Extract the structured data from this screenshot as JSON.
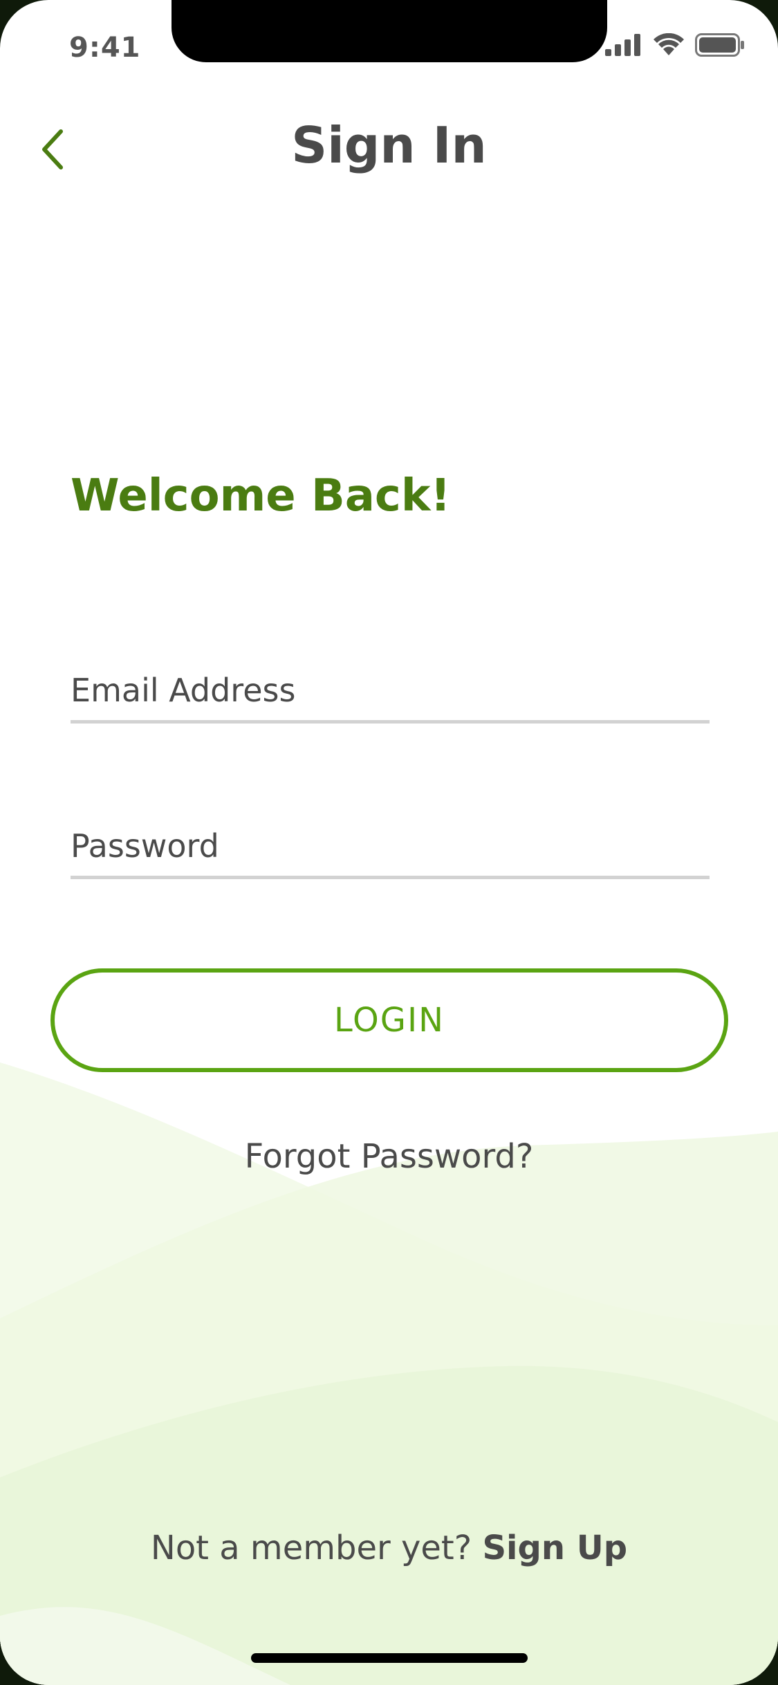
{
  "status_bar": {
    "time": "9:41",
    "icons": [
      "signal-icon",
      "wifi-icon",
      "battery-icon"
    ]
  },
  "nav": {
    "back_icon": "chevron-left-icon",
    "title": "Sign In"
  },
  "welcome": "Welcome Back!",
  "form": {
    "email_placeholder": "Email Address",
    "password_placeholder": "Password",
    "login_label": "LOGIN",
    "forgot_label": "Forgot Password?"
  },
  "footer": {
    "prompt": "Not a member yet? ",
    "signup_label": "Sign Up"
  },
  "colors": {
    "brand_dark": "#4a7c11",
    "brand": "#5aa412",
    "text": "#4a4a4a",
    "divider": "#d2d2d2",
    "wave_tint": "#e8f5d8"
  }
}
